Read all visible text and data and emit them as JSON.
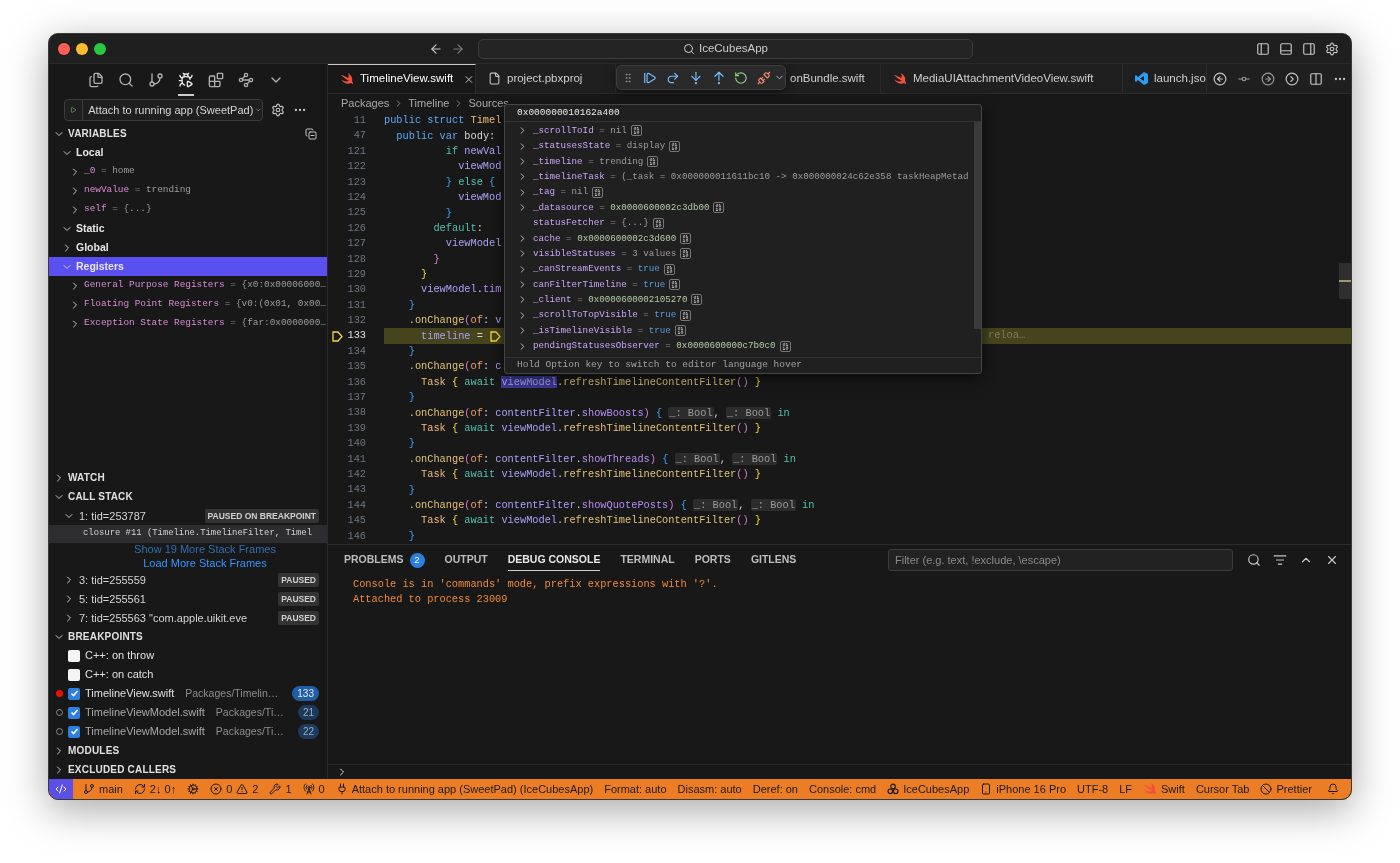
{
  "title_bar": {
    "search": "IceCubesApp"
  },
  "activity_bar": [
    {
      "kind": "files",
      "selected": false
    },
    {
      "kind": "search",
      "selected": false
    },
    {
      "kind": "scm",
      "selected": false
    },
    {
      "kind": "debug",
      "selected": true
    },
    {
      "kind": "extensions",
      "selected": false
    },
    {
      "kind": "tools",
      "selected": false
    },
    {
      "kind": "more",
      "selected": false
    }
  ],
  "launch": {
    "config": "Attach to running app (SweetPad)"
  },
  "variables": {
    "title": "VARIABLES",
    "expanded": true,
    "scopes": [
      {
        "label": "Local",
        "expanded": true,
        "selected": false,
        "children": [
          {
            "name": "_0",
            "sep": "=",
            "value": "home"
          },
          {
            "name": "newValue",
            "sep": "=",
            "value": "trending"
          },
          {
            "name": "self",
            "sep": "=",
            "value": "{...}"
          }
        ]
      },
      {
        "label": "Static",
        "expanded": true,
        "selected": false
      },
      {
        "label": "Global",
        "expanded": false,
        "selected": false
      },
      {
        "label": "Registers",
        "expanded": true,
        "selected": true,
        "children": [
          {
            "name": "General Purpose Registers",
            "sep": "=",
            "value": "{x0:0x00006000…"
          },
          {
            "name": "Floating Point Registers",
            "sep": "=",
            "value": "{v0:(0x01, 0x00…"
          },
          {
            "name": "Exception State Registers",
            "sep": "=",
            "value": "{far:0x0000000…"
          }
        ]
      }
    ]
  },
  "watch": {
    "title": "WATCH",
    "expanded": false
  },
  "call_stack": {
    "title": "CALL STACK",
    "expanded": true,
    "threads": [
      {
        "label": "1: tid=253787",
        "status": "PAUSED ON BREAKPOINT",
        "expanded": true,
        "frames": [
          {
            "label": "closure #11 (Timeline.TimelineFilter, Timel",
            "selected": true
          }
        ],
        "show_more": "Show 19 More Stack Frames",
        "load_more": "Load More Stack Frames"
      },
      {
        "label": "3: tid=255559",
        "status": "PAUSED",
        "expanded": false
      },
      {
        "label": "5: tid=255561",
        "status": "PAUSED",
        "expanded": false
      },
      {
        "label": "7: tid=255563 \"com.apple.uikit.eve",
        "status": "PAUSED",
        "expanded": false
      }
    ]
  },
  "breakpoints": {
    "title": "BREAKPOINTS",
    "expanded": true,
    "items": [
      {
        "kind": "exception",
        "label": "C++: on throw",
        "checked": false
      },
      {
        "kind": "exception",
        "label": "C++: on catch",
        "checked": false
      },
      {
        "kind": "file",
        "label": "TimelineView.swift",
        "path": "Packages/Timelin…",
        "line": "133",
        "checked": true,
        "hit": true
      },
      {
        "kind": "file",
        "label": "TimelineViewModel.swift",
        "path": "Packages/Ti…",
        "line": "21",
        "checked": true,
        "hit": false
      },
      {
        "kind": "file",
        "label": "TimelineViewModel.swift",
        "path": "Packages/Ti…",
        "line": "22",
        "checked": true,
        "hit": false
      }
    ]
  },
  "modules": {
    "title": "MODULES",
    "expanded": false
  },
  "excluded_callers": {
    "title": "EXCLUDED CALLERS",
    "expanded": false
  },
  "tabs": [
    {
      "kind": "swift",
      "label": "TimelineView.swift",
      "selected": true
    },
    {
      "kind": "file",
      "label": "project.pbxproj",
      "selected": false
    },
    {
      "kind": "hidden",
      "label": "onBundle.swift",
      "selected": false
    },
    {
      "kind": "swift",
      "label": "MediaUIAttachmentVideoView.swift",
      "selected": false
    },
    {
      "kind": "vscode",
      "label": "launch.jso",
      "selected": false
    }
  ],
  "breadcrumb": [
    "Packages",
    "Timeline",
    "Sources"
  ],
  "code_lines": [
    {
      "number": "11",
      "current": false,
      "tokens": [
        {
          "kind": "kw",
          "text": "public struct "
        },
        {
          "kind": "type",
          "text": "Timel"
        }
      ]
    },
    {
      "number": "47",
      "current": false,
      "tokens": [
        {
          "kind": "kw",
          "text": "  public var "
        },
        {
          "kind": "plain",
          "text": "body:"
        }
      ]
    },
    {
      "number": "121",
      "current": false,
      "tokens": [
        {
          "kind": "ctl",
          "text": "          if "
        },
        {
          "kind": "var",
          "text": "newVal"
        }
      ]
    },
    {
      "number": "122",
      "current": false,
      "tokens": [
        {
          "kind": "var",
          "text": "            viewMod"
        }
      ]
    },
    {
      "number": "123",
      "current": false,
      "tokens": [
        {
          "kind": "pb",
          "text": "          }"
        },
        {
          "kind": "ctl",
          "text": " else"
        },
        {
          "kind": "pb",
          "text": " {"
        }
      ]
    },
    {
      "number": "124",
      "current": false,
      "tokens": [
        {
          "kind": "var",
          "text": "            viewMod"
        }
      ]
    },
    {
      "number": "125",
      "current": false,
      "tokens": [
        {
          "kind": "pb",
          "text": "          }"
        }
      ]
    },
    {
      "number": "126",
      "current": false,
      "tokens": [
        {
          "kind": "ctl",
          "text": "        default"
        },
        {
          "kind": "plain",
          "text": ":"
        }
      ]
    },
    {
      "number": "127",
      "current": false,
      "tokens": [
        {
          "kind": "var",
          "text": "          viewModel"
        }
      ]
    },
    {
      "number": "128",
      "current": false,
      "tokens": [
        {
          "kind": "pp",
          "text": "        }"
        }
      ]
    },
    {
      "number": "129",
      "current": false,
      "tokens": [
        {
          "kind": "py",
          "text": "      }"
        }
      ]
    },
    {
      "number": "130",
      "current": false,
      "tokens": [
        {
          "kind": "var",
          "text": "      viewModel"
        },
        {
          "kind": "plain",
          "text": "."
        },
        {
          "kind": "prop",
          "text": "tim"
        }
      ]
    },
    {
      "number": "131",
      "current": false,
      "tokens": [
        {
          "kind": "pb",
          "text": "    }"
        }
      ]
    },
    {
      "number": "132",
      "current": false,
      "tokens": [
        {
          "kind": "fn",
          "text": "    .onChange"
        },
        {
          "kind": "pp",
          "text": "("
        },
        {
          "kind": "lbl",
          "text": "of"
        },
        {
          "kind": "plain",
          "text": ": "
        },
        {
          "kind": "var",
          "text": "v"
        }
      ]
    },
    {
      "number": "133",
      "current": true,
      "inline_value": "reloa…",
      "tokens": [
        {
          "kind": "var",
          "text": "      timeline"
        },
        {
          "kind": "plain",
          "text": " = "
        }
      ]
    },
    {
      "number": "134",
      "current": false,
      "tokens": [
        {
          "kind": "pb",
          "text": "    }"
        }
      ]
    },
    {
      "number": "135",
      "current": false,
      "tokens": [
        {
          "kind": "fn",
          "text": "    .onChange"
        },
        {
          "kind": "pp",
          "text": "("
        },
        {
          "kind": "lbl",
          "text": "of"
        },
        {
          "kind": "plain",
          "text": ": "
        },
        {
          "kind": "var",
          "text": "c"
        }
      ]
    },
    {
      "number": "136",
      "current": false,
      "tokens": [
        {
          "kind": "type",
          "text": "      Task"
        },
        {
          "kind": "py",
          "text": " {"
        },
        {
          "kind": "ctl",
          "text": " await "
        },
        {
          "kind": "sel",
          "text": "viewModel"
        },
        {
          "kind": "plain",
          "text": "."
        },
        {
          "kind": "fn",
          "text": "refreshTimelineContentFilter"
        },
        {
          "kind": "pp",
          "text": "()"
        },
        {
          "kind": "py",
          "text": " }"
        }
      ]
    },
    {
      "number": "137",
      "current": false,
      "tokens": [
        {
          "kind": "pb",
          "text": "    }"
        }
      ]
    },
    {
      "number": "138",
      "current": false,
      "tokens": [
        {
          "kind": "fn",
          "text": "    .onChange"
        },
        {
          "kind": "pp",
          "text": "("
        },
        {
          "kind": "lbl",
          "text": "of"
        },
        {
          "kind": "plain",
          "text": ": "
        },
        {
          "kind": "var",
          "text": "contentFilter"
        },
        {
          "kind": "plain",
          "text": "."
        },
        {
          "kind": "prop",
          "text": "showBoosts"
        },
        {
          "kind": "pp",
          "text": ")"
        },
        {
          "kind": "pb",
          "text": " { "
        },
        {
          "kind": "hint",
          "text": "_: Bool"
        },
        {
          "kind": "plain",
          "text": ", "
        },
        {
          "kind": "hint",
          "text": "_: Bool"
        },
        {
          "kind": "ctl",
          "text": " in"
        }
      ]
    },
    {
      "number": "139",
      "current": false,
      "tokens": [
        {
          "kind": "type",
          "text": "      Task"
        },
        {
          "kind": "py",
          "text": " {"
        },
        {
          "kind": "ctl",
          "text": " await "
        },
        {
          "kind": "var",
          "text": "viewModel"
        },
        {
          "kind": "plain",
          "text": "."
        },
        {
          "kind": "fn",
          "text": "refreshTimelineContentFilter"
        },
        {
          "kind": "pp",
          "text": "()"
        },
        {
          "kind": "py",
          "text": " }"
        }
      ]
    },
    {
      "number": "140",
      "current": false,
      "tokens": [
        {
          "kind": "pb",
          "text": "    }"
        }
      ]
    },
    {
      "number": "141",
      "current": false,
      "tokens": [
        {
          "kind": "fn",
          "text": "    .onChange"
        },
        {
          "kind": "pp",
          "text": "("
        },
        {
          "kind": "lbl",
          "text": "of"
        },
        {
          "kind": "plain",
          "text": ": "
        },
        {
          "kind": "var",
          "text": "contentFilter"
        },
        {
          "kind": "plain",
          "text": "."
        },
        {
          "kind": "prop",
          "text": "showThreads"
        },
        {
          "kind": "pp",
          "text": ")"
        },
        {
          "kind": "pb",
          "text": " { "
        },
        {
          "kind": "hint",
          "text": "_: Bool"
        },
        {
          "kind": "plain",
          "text": ", "
        },
        {
          "kind": "hint",
          "text": "_: Bool"
        },
        {
          "kind": "ctl",
          "text": " in"
        }
      ]
    },
    {
      "number": "142",
      "current": false,
      "tokens": [
        {
          "kind": "type",
          "text": "      Task"
        },
        {
          "kind": "py",
          "text": " {"
        },
        {
          "kind": "ctl",
          "text": " await "
        },
        {
          "kind": "var",
          "text": "viewModel"
        },
        {
          "kind": "plain",
          "text": "."
        },
        {
          "kind": "fn",
          "text": "refreshTimelineContentFilter"
        },
        {
          "kind": "pp",
          "text": "()"
        },
        {
          "kind": "py",
          "text": " }"
        }
      ]
    },
    {
      "number": "143",
      "current": false,
      "tokens": [
        {
          "kind": "pb",
          "text": "    }"
        }
      ]
    },
    {
      "number": "144",
      "current": false,
      "tokens": [
        {
          "kind": "fn",
          "text": "    .onChange"
        },
        {
          "kind": "pp",
          "text": "("
        },
        {
          "kind": "lbl",
          "text": "of"
        },
        {
          "kind": "plain",
          "text": ": "
        },
        {
          "kind": "var",
          "text": "contentFilter"
        },
        {
          "kind": "plain",
          "text": "."
        },
        {
          "kind": "prop",
          "text": "showQuotePosts"
        },
        {
          "kind": "pp",
          "text": ")"
        },
        {
          "kind": "pb",
          "text": " { "
        },
        {
          "kind": "hint",
          "text": "_: Bool"
        },
        {
          "kind": "plain",
          "text": ", "
        },
        {
          "kind": "hint",
          "text": "_: Bool"
        },
        {
          "kind": "ctl",
          "text": " in"
        }
      ]
    },
    {
      "number": "145",
      "current": false,
      "tokens": [
        {
          "kind": "type",
          "text": "      Task"
        },
        {
          "kind": "py",
          "text": " {"
        },
        {
          "kind": "ctl",
          "text": " await "
        },
        {
          "kind": "var",
          "text": "viewModel"
        },
        {
          "kind": "plain",
          "text": "."
        },
        {
          "kind": "fn",
          "text": "refreshTimelineContentFilter"
        },
        {
          "kind": "pp",
          "text": "()"
        },
        {
          "kind": "py",
          "text": " }"
        }
      ]
    },
    {
      "number": "146",
      "current": false,
      "tokens": [
        {
          "kind": "pb",
          "text": "    }"
        }
      ]
    }
  ],
  "hover": {
    "address": "0x000000010162a400",
    "rows": [
      {
        "name": "_scrollToId",
        "sep": "=",
        "value": "nil",
        "kind": "text",
        "expandable": true
      },
      {
        "name": "_statusesState",
        "sep": "=",
        "value": "display",
        "kind": "text",
        "expandable": true
      },
      {
        "name": "_timeline",
        "sep": "=",
        "value": "trending",
        "kind": "text",
        "expandable": true
      },
      {
        "name": "_timelineTask",
        "sep": "=",
        "value": "(_task = 0x000000011611bc10 -> 0x000000024c62e358 taskHeapMetad",
        "kind": "text",
        "expandable": true
      },
      {
        "name": "_tag",
        "sep": "=",
        "value": "nil",
        "kind": "text",
        "expandable": true
      },
      {
        "name": "_datasource",
        "sep": "=",
        "value": "0x0000600002c3db00",
        "kind": "number",
        "expandable": true
      },
      {
        "name": "statusFetcher",
        "sep": "=",
        "value": "{...}",
        "kind": "text",
        "expandable": false
      },
      {
        "name": "cache",
        "sep": "=",
        "value": "0x0000600002c3d600",
        "kind": "number",
        "expandable": true
      },
      {
        "name": "visibleStatuses",
        "sep": "=",
        "value": "3 values",
        "kind": "text",
        "expandable": true
      },
      {
        "name": "_canStreamEvents",
        "sep": "=",
        "value": "true",
        "kind": "bool",
        "expandable": true
      },
      {
        "name": "canFilterTimeline",
        "sep": "=",
        "value": "true",
        "kind": "bool",
        "expandable": true
      },
      {
        "name": "_client",
        "sep": "=",
        "value": "0x0000600002105270",
        "kind": "number",
        "expandable": true
      },
      {
        "name": "_scrollToTopVisible",
        "sep": "=",
        "value": "true",
        "kind": "bool",
        "expandable": true
      },
      {
        "name": "_isTimelineVisible",
        "sep": "=",
        "value": "true",
        "kind": "bool",
        "expandable": true
      },
      {
        "name": "pendingStatusesObserver",
        "sep": "=",
        "value": "0x0000600000c7b0c0",
        "kind": "number",
        "expandable": true
      }
    ],
    "footer": "Hold Option key to switch to editor language hover"
  },
  "panel": {
    "tabs": [
      {
        "label": "PROBLEMS",
        "badge": "2",
        "selected": false
      },
      {
        "label": "OUTPUT",
        "selected": false
      },
      {
        "label": "DEBUG CONSOLE",
        "selected": true
      },
      {
        "label": "TERMINAL",
        "selected": false
      },
      {
        "label": "PORTS",
        "selected": false
      },
      {
        "label": "GITLENS",
        "selected": false
      }
    ],
    "filter": {
      "placeholder": "Filter (e.g. text, !exclude, \\escape)"
    },
    "console": [
      "Console is in 'commands' mode, prefix expressions with '?'.",
      "Attached to process 23009"
    ]
  },
  "status_bar": [
    {
      "kind": "branch",
      "text": "main"
    },
    {
      "kind": "sync",
      "text": "2↓ 0↑"
    },
    {
      "kind": "cog"
    },
    {
      "kind": "errors",
      "text": "0"
    },
    {
      "kind": "warnings",
      "text": "2"
    },
    {
      "kind": "tools",
      "text": "1"
    },
    {
      "kind": "ports",
      "text": "0"
    },
    {
      "kind": "debug",
      "text": "Attach to running app (SweetPad) (IceCubesApp)"
    },
    {
      "kind": "plain",
      "text": "Format: auto"
    },
    {
      "kind": "plain",
      "text": "Disasm: auto"
    },
    {
      "kind": "plain",
      "text": "Deref: on"
    },
    {
      "kind": "plain",
      "text": "Console: cmd"
    },
    {
      "kind": "app",
      "text": "IceCubesApp"
    },
    {
      "kind": "device",
      "text": "iPhone 16 Pro"
    },
    {
      "kind": "plain",
      "text": "UTF-8"
    },
    {
      "kind": "plain",
      "text": "LF"
    },
    {
      "kind": "language",
      "text": "Swift"
    },
    {
      "kind": "plain",
      "text": "Cursor Tab"
    },
    {
      "kind": "prettier",
      "text": "Prettier"
    },
    {
      "kind": "bell"
    }
  ]
}
